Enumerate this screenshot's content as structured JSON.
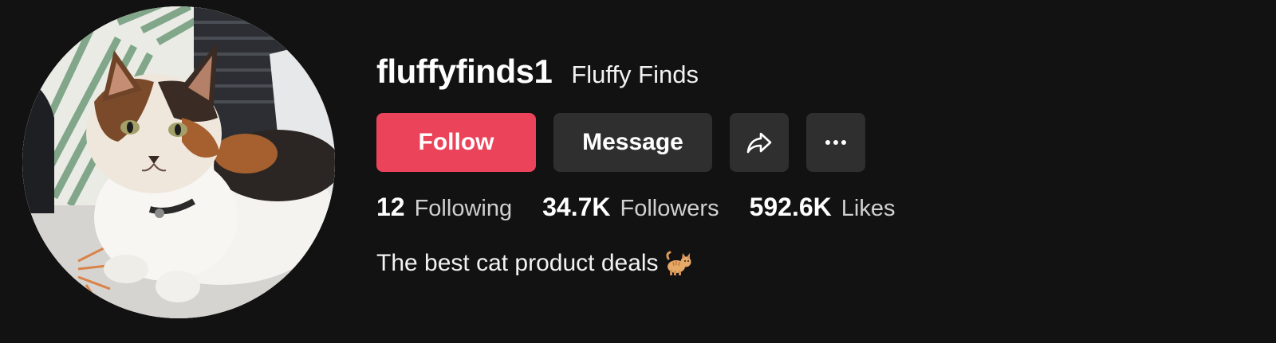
{
  "profile": {
    "username": "fluffyfinds1",
    "display_name": "Fluffy Finds",
    "bio_text": "The best cat product deals",
    "bio_emoji": "cat-emoji"
  },
  "actions": {
    "follow_label": "Follow",
    "message_label": "Message",
    "share_icon": "share-icon",
    "more_icon": "more-options-icon"
  },
  "stats": {
    "following_count": "12",
    "following_label": "Following",
    "followers_count": "34.7K",
    "followers_label": "Followers",
    "likes_count": "592.6K",
    "likes_label": "Likes"
  },
  "colors": {
    "background": "#121212",
    "follow_button": "#ea435a",
    "secondary_button": "#2f2f2f"
  }
}
